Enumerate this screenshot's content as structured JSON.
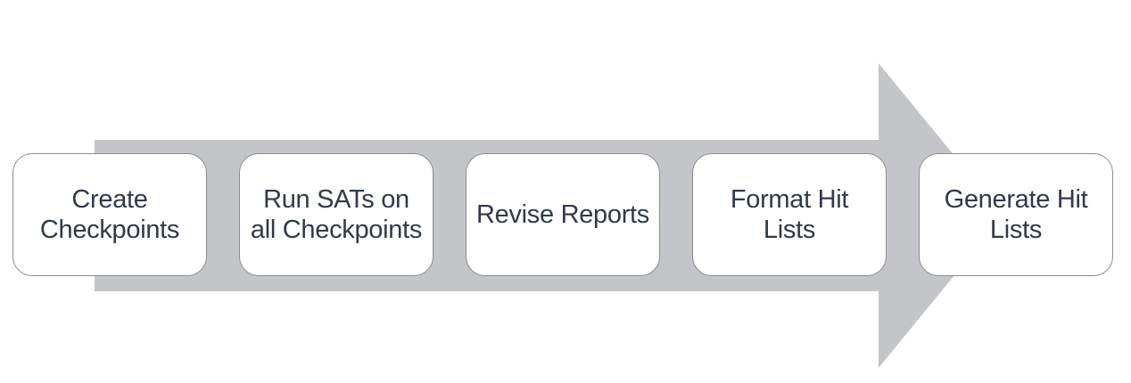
{
  "diagram": {
    "colors": {
      "arrow": "#c4c5c8",
      "box_fill": "#ffffff",
      "box_border": "#8c8c8c",
      "text": "#2f3a4b"
    },
    "steps": [
      {
        "label": "Create\nCheckpoints"
      },
      {
        "label": "Run SATs on\nall Checkpoints"
      },
      {
        "label": "Revise Reports"
      },
      {
        "label": "Format Hit\nLists"
      },
      {
        "label": "Generate  Hit\nLists"
      }
    ]
  }
}
